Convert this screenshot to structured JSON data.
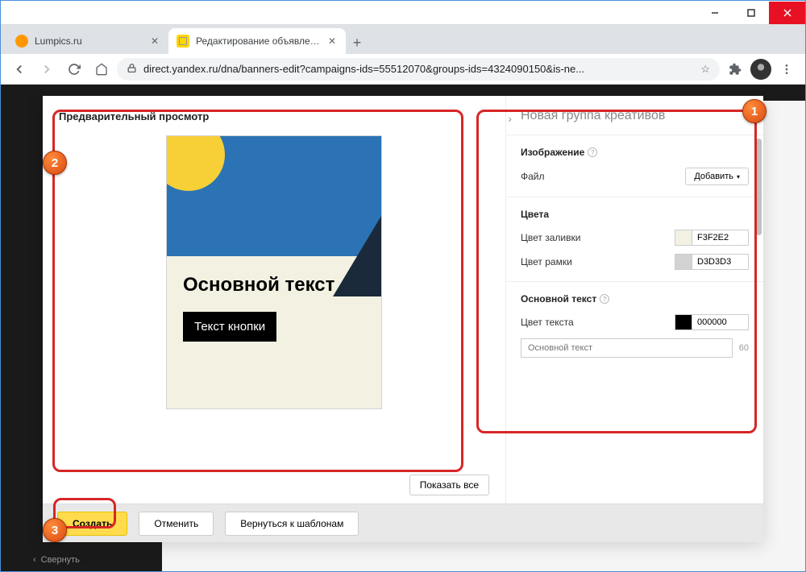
{
  "tabs": [
    {
      "title": "Lumpics.ru"
    },
    {
      "title": "Редактирование объявлений"
    }
  ],
  "url": "direct.yandex.ru/dna/banners-edit?campaigns-ids=55512070&groups-ids=4324090150&is-ne...",
  "collapse_label": "Свернуть",
  "preview": {
    "title": "Предварительный просмотр",
    "main_text": "Основной текст",
    "button_text": "Текст кнопки",
    "show_all": "Показать все"
  },
  "settings": {
    "header": "Новая группа креативов",
    "image_section": "Изображение",
    "file_label": "Файл",
    "add_label": "Добавить",
    "colors_section": "Цвета",
    "fill_label": "Цвет заливки",
    "fill_value": "F3F2E2",
    "border_label": "Цвет рамки",
    "border_value": "D3D3D3",
    "maintext_section": "Основной текст",
    "textcolor_label": "Цвет текста",
    "textcolor_value": "000000",
    "text_placeholder": "Основной текст",
    "char_limit": "60"
  },
  "footer": {
    "create": "Создать",
    "cancel": "Отменить",
    "back": "Вернуться к шаблонам"
  },
  "annotations": {
    "b1": "1",
    "b2": "2",
    "b3": "3"
  }
}
